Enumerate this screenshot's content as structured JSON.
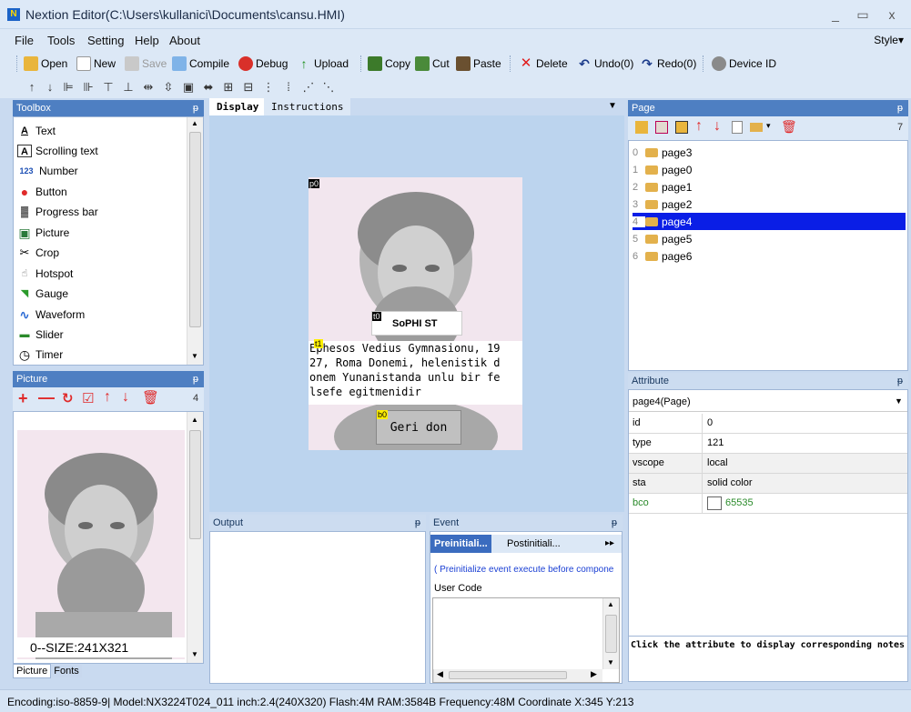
{
  "window": {
    "title": "Nextion Editor(C:\\Users\\kullanici\\Documents\\cansu.HMI)",
    "logo": "N",
    "minimize": "_",
    "maximize": "▭",
    "close": "x"
  },
  "menu": {
    "items": [
      "File",
      "Tools",
      "Setting",
      "Help",
      "About"
    ],
    "style": "Style▾"
  },
  "toolbar": {
    "open": "Open",
    "new": "New",
    "save": "Save",
    "compile": "Compile",
    "debug": "Debug",
    "upload": "Upload",
    "copy": "Copy",
    "cut": "Cut",
    "paste": "Paste",
    "delete": "Delete",
    "undo": "Undo(0)",
    "redo": "Redo(0)",
    "device_id": "Device ID"
  },
  "toolbox": {
    "title": "Toolbox",
    "items": [
      {
        "icon": "text-icon",
        "glyph": "A",
        "label": "Text"
      },
      {
        "icon": "scrolling-text-icon",
        "glyph": "A",
        "label": "Scrolling text"
      },
      {
        "icon": "number-icon",
        "glyph": "123",
        "label": "Number"
      },
      {
        "icon": "button-icon",
        "glyph": "●",
        "label": "Button"
      },
      {
        "icon": "progress-bar-icon",
        "glyph": "▓",
        "label": "Progress bar"
      },
      {
        "icon": "picture-icon",
        "glyph": "▣",
        "label": "Picture"
      },
      {
        "icon": "crop-icon",
        "glyph": "✂",
        "label": "Crop"
      },
      {
        "icon": "hotspot-icon",
        "glyph": "☝",
        "label": "Hotspot"
      },
      {
        "icon": "gauge-icon",
        "glyph": "◥",
        "label": "Gauge"
      },
      {
        "icon": "waveform-icon",
        "glyph": "∿",
        "label": "Waveform"
      },
      {
        "icon": "slider-icon",
        "glyph": "▬",
        "label": "Slider"
      },
      {
        "icon": "timer-icon",
        "glyph": "◷",
        "label": "Timer"
      }
    ]
  },
  "picture_panel": {
    "title": "Picture",
    "count": "4",
    "size_label": "0--SIZE:241X321",
    "tabs": [
      "Picture",
      "Fonts"
    ]
  },
  "display": {
    "tabs": [
      "Display",
      "Instructions"
    ],
    "objects": {
      "p0_tag": "p0",
      "t0_tag": "t0",
      "t0_text": "SoPHI ST",
      "t1_tag": "t1",
      "t1_text": "Ephesos Vedius Gymnasionu, 1927, Roma Donemi, helenistik donem Yunanistanda unlu bir felsefe egitmenidir",
      "t1_lines": [
        "Ephesos Vedius Gymnasionu, 19",
        "27, Roma Donemi, helenistik d",
        "onem Yunanistanda unlu bir fe",
        "lsefe egitmenidir"
      ],
      "b0_tag": "b0",
      "b0_text": "Geri don"
    }
  },
  "output": {
    "title": "Output"
  },
  "event": {
    "title": "Event",
    "tabs": [
      "Preinitiali...",
      "Postinitiali..."
    ],
    "note": "( Preinitialize event execute before compone",
    "user_code_label": "User Code"
  },
  "page_panel": {
    "title": "Page",
    "count": "7",
    "pages": [
      {
        "num": "0",
        "name": "page3"
      },
      {
        "num": "1",
        "name": "page0"
      },
      {
        "num": "2",
        "name": "page1"
      },
      {
        "num": "3",
        "name": "page2"
      },
      {
        "num": "4",
        "name": "page4"
      },
      {
        "num": "5",
        "name": "page5"
      },
      {
        "num": "6",
        "name": "page6"
      }
    ],
    "selected_index": 4
  },
  "attribute": {
    "title": "Attribute",
    "selected": "page4(Page)",
    "rows": [
      {
        "key": "id",
        "value": "0"
      },
      {
        "key": "type",
        "value": "121"
      },
      {
        "key": "vscope",
        "value": "local"
      },
      {
        "key": "sta",
        "value": "solid color"
      },
      {
        "key": "bco",
        "value": "65535"
      }
    ],
    "notes": "Click the attribute to display corresponding notes"
  },
  "statusbar": {
    "text": "Encoding:iso-8859-9| Model:NX3224T024_011  inch:2.4(240X320) Flash:4M RAM:3584B Frequency:48M    Coordinate X:345  Y:213"
  }
}
